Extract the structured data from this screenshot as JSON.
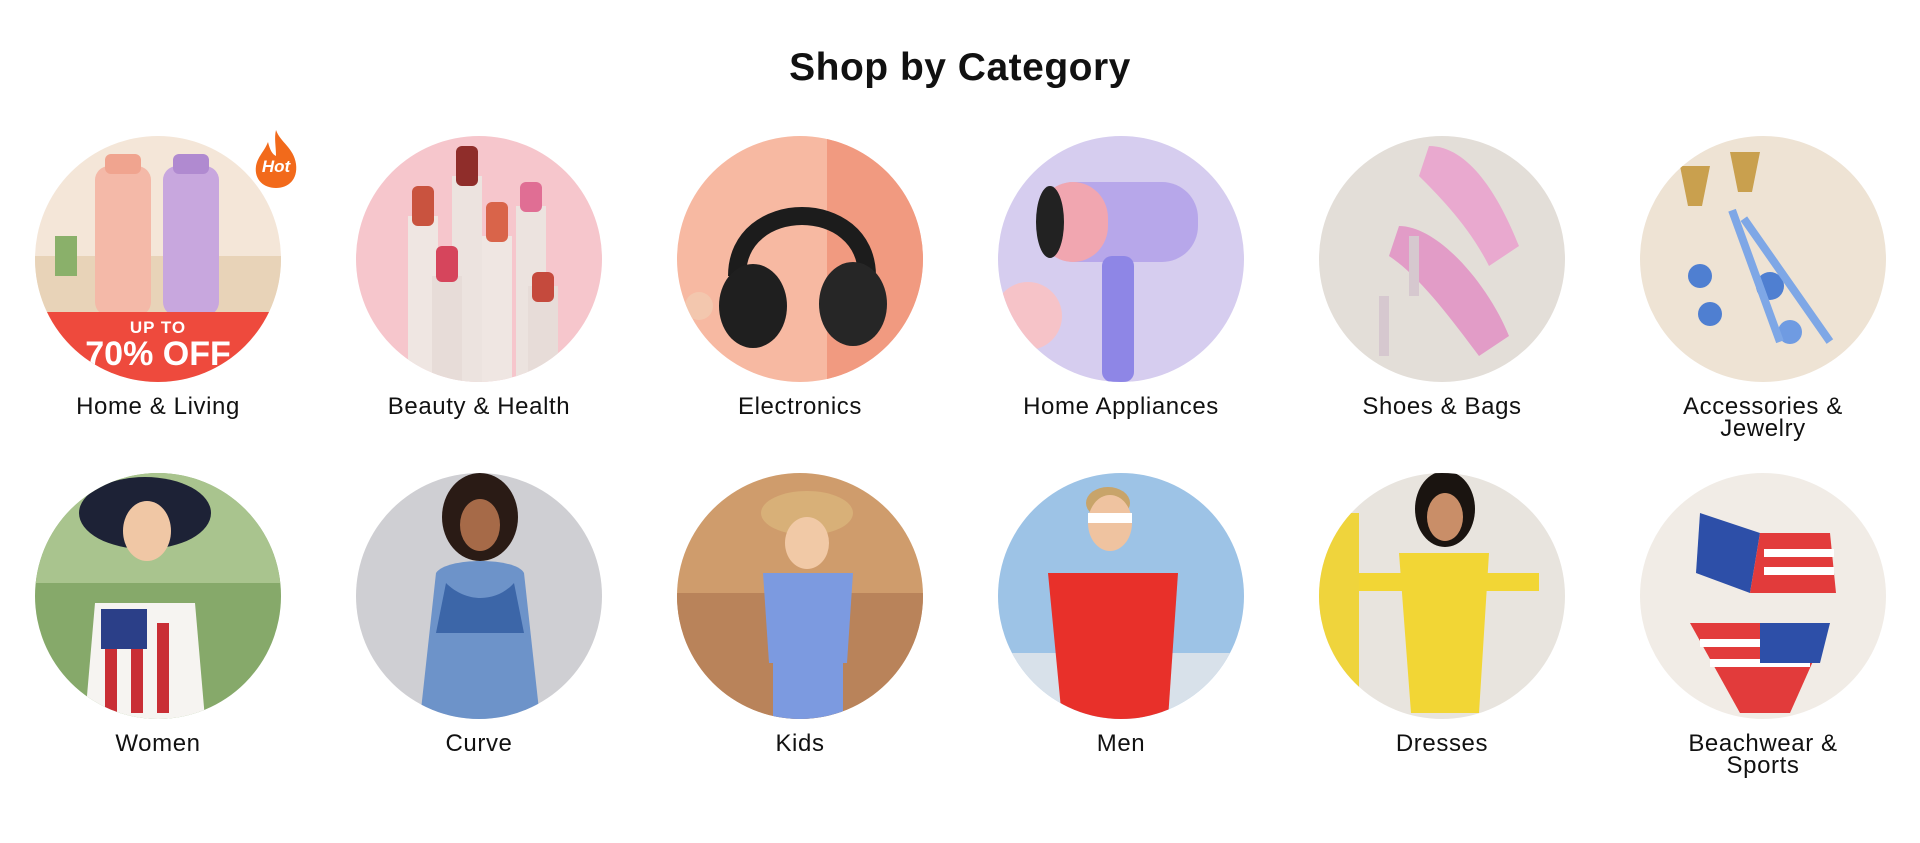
{
  "section": {
    "title": "Shop by Category"
  },
  "categories": [
    {
      "label": "Home & Living",
      "badge": "Hot",
      "promo_small": "UP TO",
      "promo_big": "70% OFF",
      "icon": "water-bottles-image"
    },
    {
      "label": "Beauty & Health",
      "icon": "lipsticks-image"
    },
    {
      "label": "Electronics",
      "icon": "headphones-image"
    },
    {
      "label": "Home Appliances",
      "icon": "hair-dryer-image"
    },
    {
      "label": "Shoes & Bags",
      "icon": "heels-image"
    },
    {
      "label": "Accessories & Jewelry",
      "label_line1": "Accessories &",
      "label_line2": "Jewelry",
      "icon": "earrings-image"
    },
    {
      "label": "Women",
      "icon": "woman-in-hat-image"
    },
    {
      "label": "Curve",
      "icon": "curve-model-image"
    },
    {
      "label": "Kids",
      "icon": "girl-in-hat-image"
    },
    {
      "label": "Men",
      "icon": "man-red-tee-image"
    },
    {
      "label": "Dresses",
      "icon": "yellow-dress-image"
    },
    {
      "label": "Beachwear & Sports",
      "label_line1": "Beachwear &",
      "label_line2": "Sports",
      "icon": "bikini-image"
    }
  ],
  "colors": {
    "promo_red": "#ee4a3d",
    "hot_orange": "#f26a1b",
    "text": "#111111"
  }
}
